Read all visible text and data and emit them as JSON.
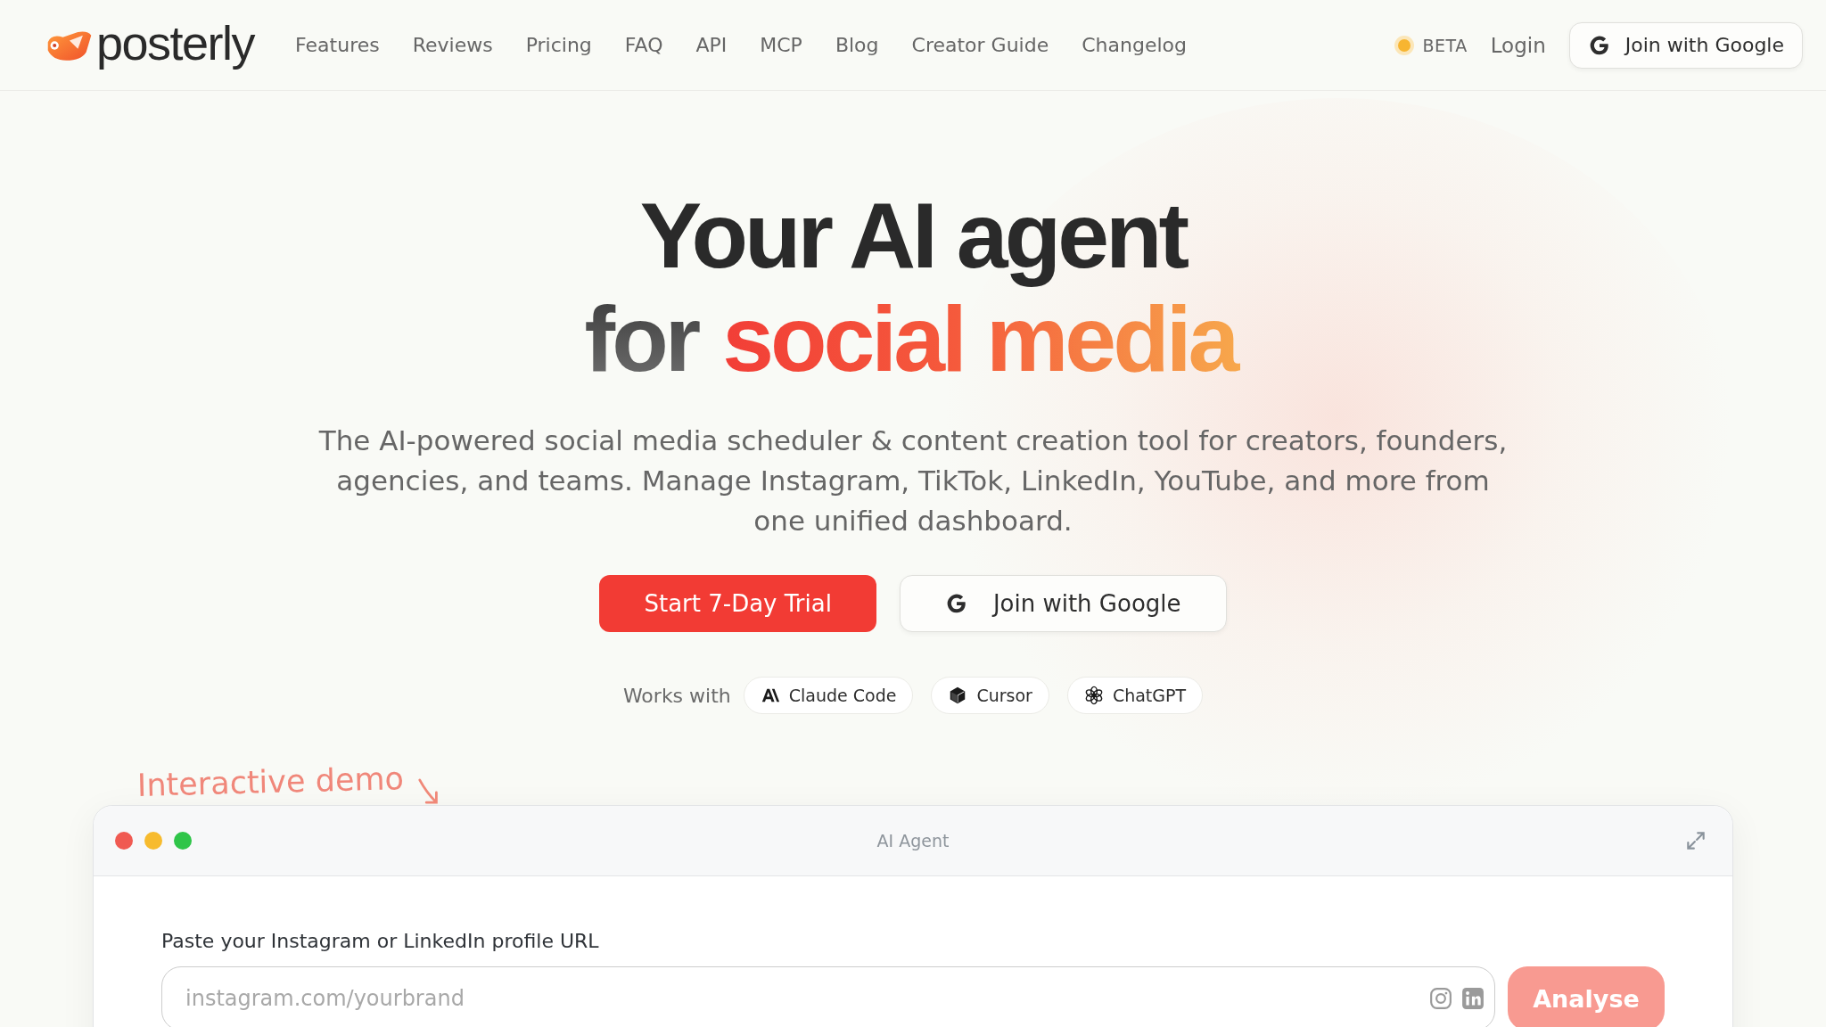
{
  "nav": {
    "brand": "posterly",
    "links": [
      "Features",
      "Reviews",
      "Pricing",
      "FAQ",
      "API",
      "MCP",
      "Blog",
      "Creator Guide",
      "Changelog"
    ],
    "badge": "BETA",
    "login": "Login",
    "google_button": "Join with Google"
  },
  "hero": {
    "headline": [
      {
        "text": "Your AI agent",
        "kind": "plain"
      },
      {
        "text": "for",
        "kind": "muted"
      },
      {
        "text": "social media",
        "kind": "accent"
      }
    ],
    "subtitle": "The AI-powered social media scheduler & content creation tool for creators, founders, agencies, and teams. Manage Instagram, TikTok, LinkedIn, YouTube, and more from one unified dashboard.",
    "primary_button": "Start 7-Day Trial",
    "google_button": "Join with Google",
    "works_with_label": "Works with",
    "integrations": [
      {
        "name": "Claude Code",
        "kind": "claude"
      },
      {
        "name": "Cursor",
        "kind": "cursor"
      },
      {
        "name": "ChatGPT",
        "kind": "chatgpt"
      }
    ]
  },
  "demo": {
    "caption": "Interactive demo",
    "window_title": "AI Agent",
    "field_label": "Paste your Instagram or LinkedIn profile URL",
    "placeholder": "instagram.com/yourbrand",
    "analyse_button": "Analyse"
  }
}
